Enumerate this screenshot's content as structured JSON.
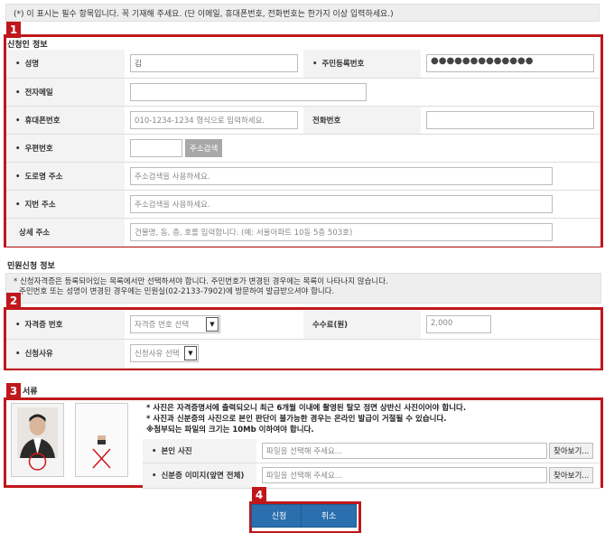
{
  "notice": "(*) 이 표시는 필수 항목입니다. 꼭 기재해 주세요. (단 이메일, 휴대폰번호, 전화번호는 한가지 이상 입력하세요.)",
  "badges": [
    "1",
    "2",
    "3",
    "4"
  ],
  "applicant": {
    "title": "신청인 정보",
    "name_label": "성명",
    "name_value": "김",
    "rrn_label": "주민등록번호",
    "rrn_value": "●●●●●●●●●●●●●",
    "email_label": "전자메일",
    "mobile_label": "휴대폰번호",
    "mobile_placeholder": "010-1234-1234 형식으로 입력하세요.",
    "phone_label": "전화번호",
    "zip_label": "우편번호",
    "zip_button": "주소검색",
    "road_label": "도로명 주소",
    "road_placeholder": "주소검색을 사용하세요.",
    "lot_label": "지번 주소",
    "lot_placeholder": "주소검색을 사용하세요.",
    "detail_label": "상세 주소",
    "detail_placeholder": "건물명, 동, 층, 호를 입력합니다. (예: 서울아파트 10동 5층 503호)"
  },
  "petition": {
    "title": "민원신청 정보",
    "info_line1": "* 신청자격증은 등록되어있는 목록에서만 선택하셔야 합니다. 주민번호가 변경된 경우에는 목록이 나타나지 않습니다.",
    "info_line2": "주민번호 또는 성명이 변경된 경우에는 민원실(02-2133-7902)에 방문하여 발급받으셔야 합니다.",
    "cert_label": "자격증 번호",
    "cert_select": "자격증 번호 선택",
    "fee_label": "수수료(원)",
    "fee_value": "2,000",
    "reason_label": "신청사유",
    "reason_select": "신청사유 선택"
  },
  "docs": {
    "title": "서류",
    "note1": "* 사진은 자격증명서에 출력되오니 최근 6개월 이내에 촬영된 탈모 정면 상반신 사진이어야 합니다.",
    "note2": "* 사진과 신분증의 사진으로 본인 판단이 불가능한 경우는 온라인 발급이 거절될 수 있습니다.",
    "note3": "※첨부되는 파일의 크기는 10Mb 이하여야 합니다.",
    "photo_label": "본인 사진",
    "id_label": "신분증 이미지(앞면 전체)",
    "file_placeholder": "파일을 선택해 주세요...",
    "browse": "찾아보기..."
  },
  "actions": {
    "submit": "신청",
    "cancel": "취소"
  },
  "colors": {
    "highlight": "#c0171b",
    "button": "#2a6fae"
  }
}
